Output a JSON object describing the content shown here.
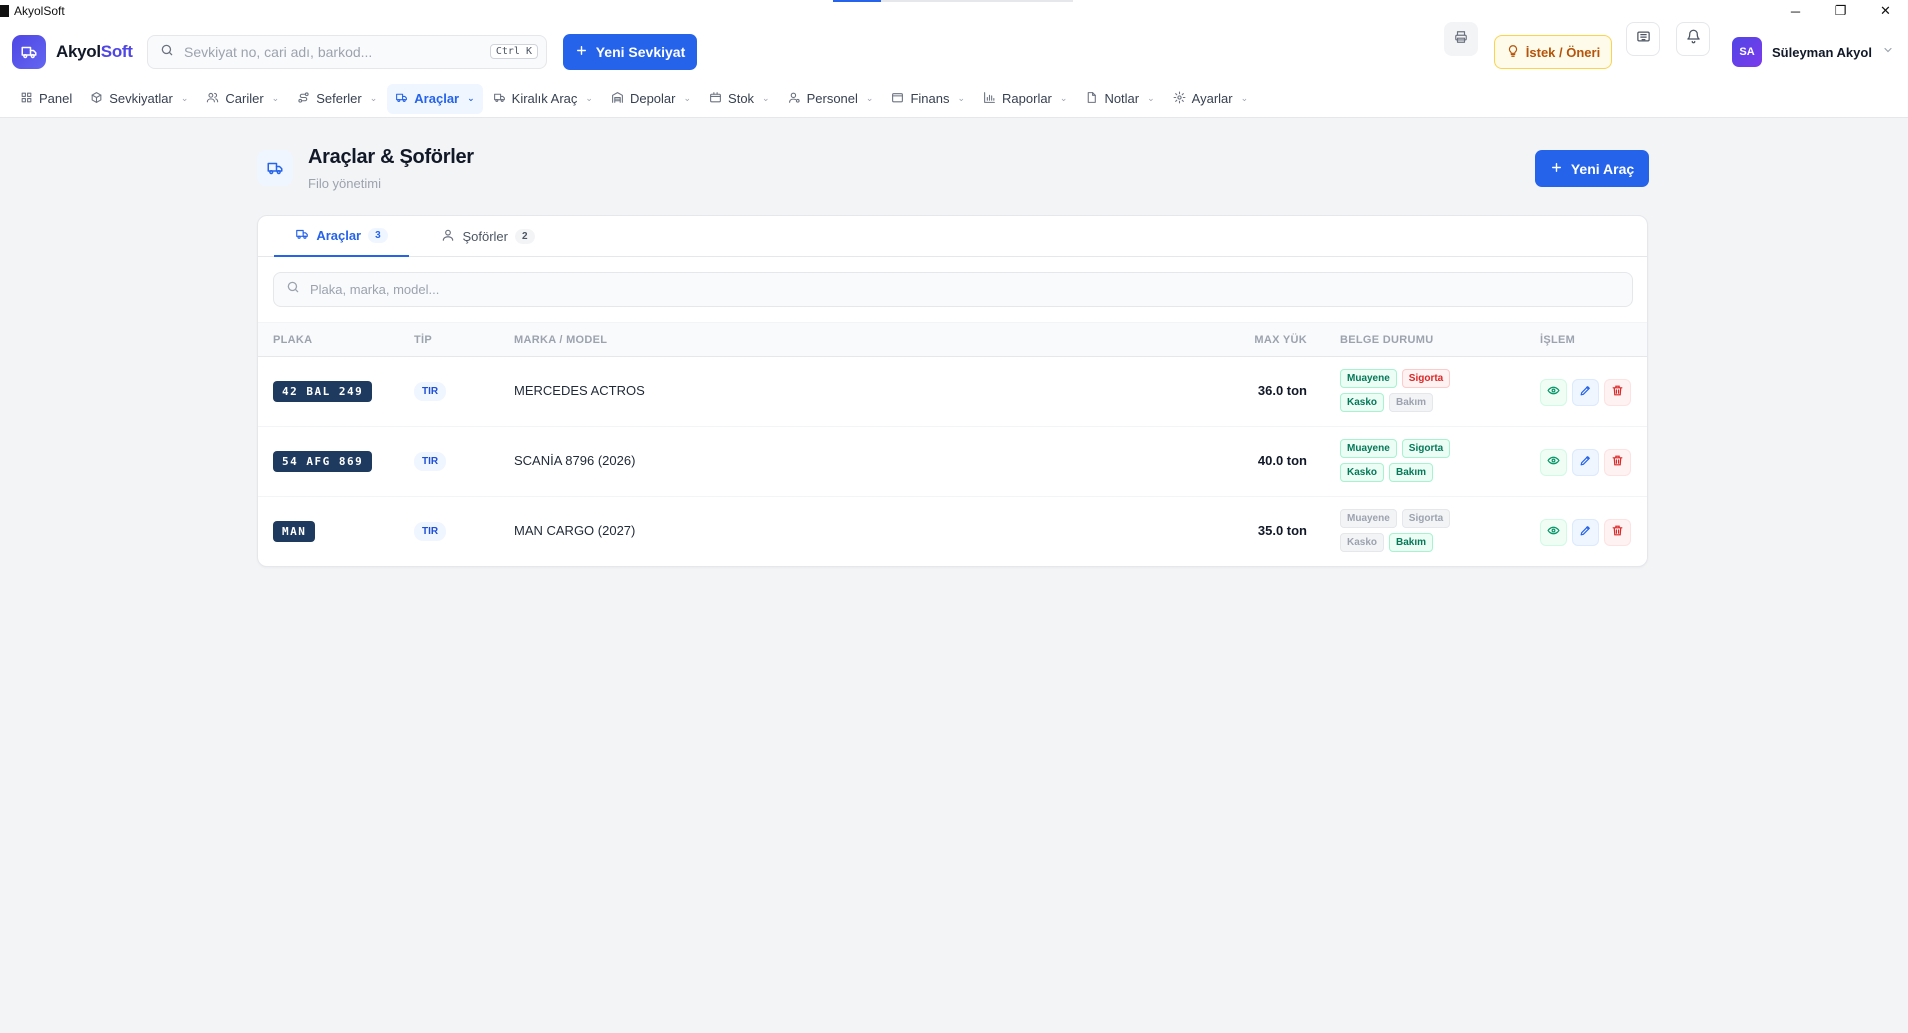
{
  "window": {
    "title": "AkyolSoft",
    "controls": {
      "minimize": "─",
      "restore": "❐",
      "close": "✕"
    }
  },
  "header": {
    "brand_main": "Akyol",
    "brand_accent": "Soft",
    "search_placeholder": "Sevkiyat no, cari adı, barkod...",
    "search_shortcut": "Ctrl K",
    "new_shipment_label": "Yeni Sevkiyat",
    "suggest_label": "İstek / Öneri",
    "user_initials": "SA",
    "user_name": "Süleyman Akyol"
  },
  "nav": {
    "items": [
      {
        "label": "Panel",
        "icon": "grid-icon",
        "has_menu": false
      },
      {
        "label": "Sevkiyatlar",
        "icon": "box-icon",
        "has_menu": true
      },
      {
        "label": "Cariler",
        "icon": "users-icon",
        "has_menu": true
      },
      {
        "label": "Seferler",
        "icon": "route-icon",
        "has_menu": true
      },
      {
        "label": "Araçlar",
        "icon": "truck-icon",
        "has_menu": true,
        "active": true
      },
      {
        "label": "Kiralık Araç",
        "icon": "car-icon",
        "has_menu": true
      },
      {
        "label": "Depolar",
        "icon": "warehouse-icon",
        "has_menu": true
      },
      {
        "label": "Stok",
        "icon": "package-icon",
        "has_menu": true
      },
      {
        "label": "Personel",
        "icon": "user-cog-icon",
        "has_menu": true
      },
      {
        "label": "Finans",
        "icon": "wallet-icon",
        "has_menu": true
      },
      {
        "label": "Raporlar",
        "icon": "bar-chart-icon",
        "has_menu": true
      },
      {
        "label": "Notlar",
        "icon": "file-icon",
        "has_menu": true
      },
      {
        "label": "Ayarlar",
        "icon": "settings-icon",
        "has_menu": true
      }
    ]
  },
  "page": {
    "title": "Araçlar & Şoförler",
    "subtitle": "Filo yönetimi",
    "new_vehicle_label": "Yeni Araç"
  },
  "tabs": {
    "vehicles": {
      "label": "Araçlar",
      "count": "3"
    },
    "drivers": {
      "label": "Şoförler",
      "count": "2"
    }
  },
  "table": {
    "search_placeholder": "Plaka, marka, model...",
    "columns": {
      "plate": "PLAKA",
      "type": "TİP",
      "model": "MARKA / MODEL",
      "max_load": "MAX YÜK",
      "documents": "BELGE DURUMU",
      "actions": "İŞLEM"
    },
    "rows": [
      {
        "plate": "42 BAL 249",
        "type": "TIR",
        "model": "MERCEDES ACTROS",
        "max_load": "36.0 ton",
        "documents": [
          {
            "label": "Muayene",
            "status": "ok"
          },
          {
            "label": "Sigorta",
            "status": "bad"
          },
          {
            "label": "Kasko",
            "status": "ok"
          },
          {
            "label": "Bakım",
            "status": "none"
          }
        ]
      },
      {
        "plate": "54 AFG 869",
        "type": "TIR",
        "model": "SCANİA 8796 (2026)",
        "max_load": "40.0 ton",
        "documents": [
          {
            "label": "Muayene",
            "status": "ok"
          },
          {
            "label": "Sigorta",
            "status": "ok"
          },
          {
            "label": "Kasko",
            "status": "ok"
          },
          {
            "label": "Bakım",
            "status": "ok"
          }
        ]
      },
      {
        "plate": "MAN",
        "type": "TIR",
        "model": "MAN CARGO (2027)",
        "max_load": "35.0 ton",
        "documents": [
          {
            "label": "Muayene",
            "status": "none"
          },
          {
            "label": "Sigorta",
            "status": "none"
          },
          {
            "label": "Kasko",
            "status": "none"
          },
          {
            "label": "Bakım",
            "status": "ok"
          }
        ]
      }
    ]
  },
  "colors": {
    "primary": "#2563eb",
    "brand": "#4f46e5",
    "plate_bg": "#1e3a5f",
    "doc_ok": "#047857",
    "doc_bad": "#dc2626",
    "doc_none": "#9ca3af"
  }
}
